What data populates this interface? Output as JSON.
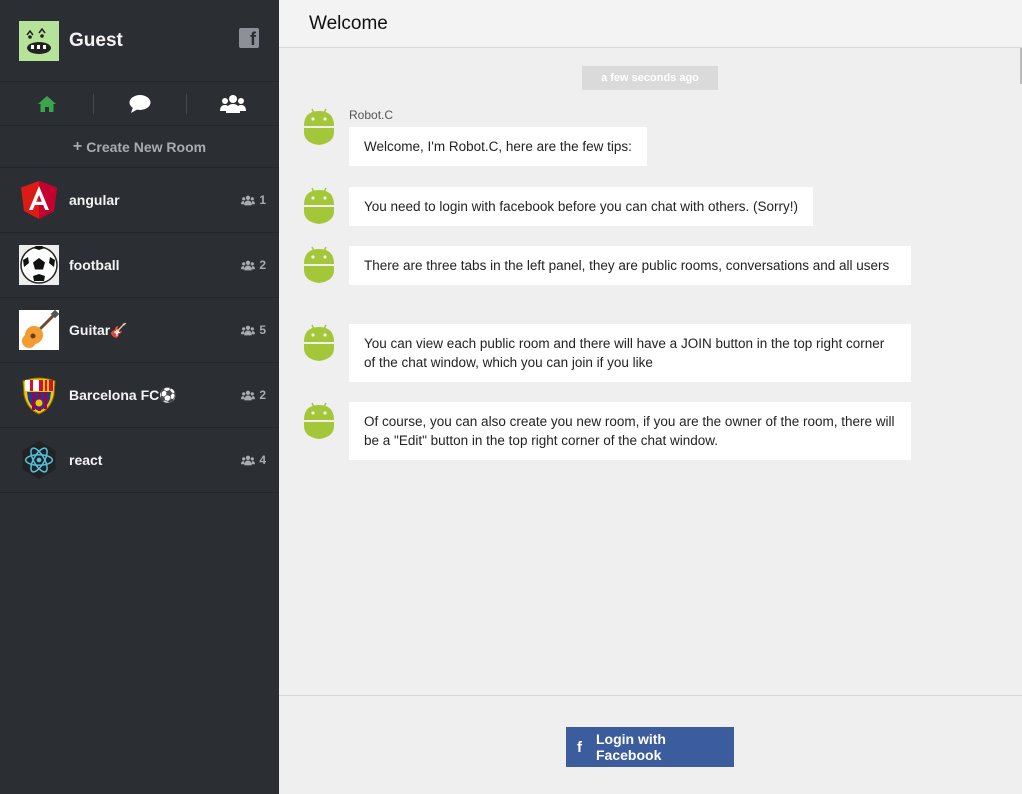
{
  "profile": {
    "name": "Guest"
  },
  "sidebar": {
    "create_room_label": "Create New Room",
    "rooms": [
      {
        "name": "angular",
        "count": "1",
        "icon": "angular-logo-icon"
      },
      {
        "name": "football",
        "count": "2",
        "icon": "soccer-ball-icon"
      },
      {
        "name": "Guitar🎸",
        "count": "5",
        "icon": "guitar-icon"
      },
      {
        "name": "Barcelona FC⚽",
        "count": "2",
        "icon": "barcelona-crest-icon"
      },
      {
        "name": "react",
        "count": "4",
        "icon": "react-logo-icon"
      }
    ]
  },
  "header": {
    "title": "Welcome"
  },
  "chat": {
    "timestamp": "a few seconds ago",
    "sender": "Robot.C",
    "messages": [
      "Welcome, I'm Robot.C, here are the few tips:",
      "You need to login with facebook before you can chat with others. (Sorry!)",
      "There are three tabs in the left panel, they are public rooms, conversations and all users",
      "You can view each public room and there will have a JOIN button in the top right corner of the chat window, which you can join if you like",
      "Of course, you can also create you new room, if you are the owner of the room, there will be a \"Edit\" button in the top right corner of the chat window."
    ]
  },
  "footer": {
    "login_label": "Login with Facebook"
  },
  "colors": {
    "sidebar": "#2b2e33",
    "active_tab": "#3aa54b",
    "robot": "#a4c639",
    "facebook": "#3c5d9d"
  }
}
